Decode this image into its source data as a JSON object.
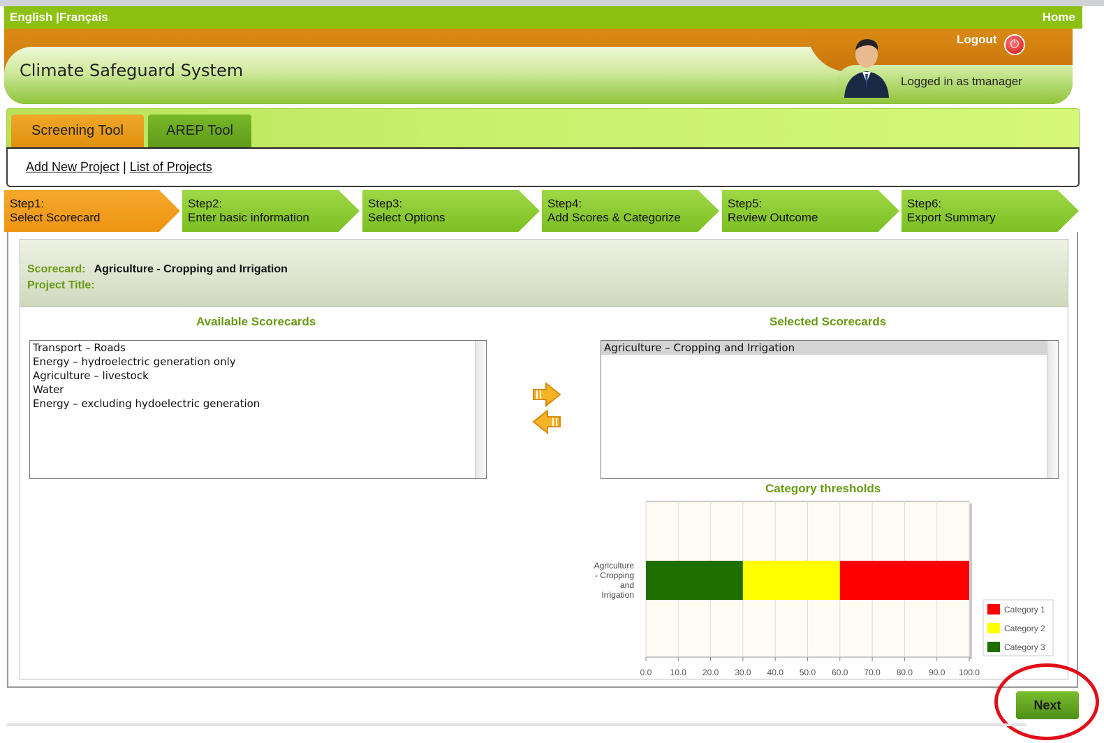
{
  "langbar": {
    "english": "English",
    "separator": " |",
    "francais": "Français",
    "home": "Home"
  },
  "header": {
    "title": "Climate Safeguard System",
    "logout": "Logout",
    "logged_in": "Logged in as tmanager"
  },
  "tools": {
    "screening": "Screening Tool",
    "arep": "AREP Tool"
  },
  "subnav": {
    "add_new": "Add New Project",
    "sep": " | ",
    "list": "List of Projects"
  },
  "steps": [
    {
      "num": "Step1:",
      "label": "Select Scorecard"
    },
    {
      "num": "Step2:",
      "label": "Enter basic information"
    },
    {
      "num": "Step3:",
      "label": "Select Options"
    },
    {
      "num": "Step4:",
      "label": "Add Scores & Categorize"
    },
    {
      "num": "Step5:",
      "label": "Review Outcome"
    },
    {
      "num": "Step6:",
      "label": "Export Summary"
    }
  ],
  "card": {
    "scorecard_label": "Scorecard:",
    "scorecard_value": "Agriculture - Cropping and Irrigation",
    "project_title_label": "Project Title:"
  },
  "available": {
    "title": "Available Scorecards",
    "items": [
      "Transport – Roads",
      "Energy – hydroelectric generation only",
      "Agriculture – livestock",
      "Water",
      "Energy – excluding hydoelectric generation"
    ]
  },
  "selected": {
    "title": "Selected Scorecards",
    "items": [
      "Agriculture – Cropping and Irrigation"
    ]
  },
  "chart_data": {
    "type": "bar",
    "title": "Category thresholds",
    "orientation": "horizontal-stacked",
    "categories": [
      "Agriculture - Cropping and Irrigation"
    ],
    "category_lines": [
      "Agriculture",
      "- Cropping",
      "and",
      "Irrigation"
    ],
    "series": [
      {
        "name": "Category 3",
        "values": [
          30
        ],
        "color": "#1e6e00"
      },
      {
        "name": "Category 2",
        "values": [
          30
        ],
        "color": "#ffff00"
      },
      {
        "name": "Category 1",
        "values": [
          40
        ],
        "color": "#ff0000"
      }
    ],
    "legend": [
      "Category 1",
      "Category 2",
      "Category 3"
    ],
    "xlim": [
      0,
      100
    ],
    "xticks": [
      "0.0",
      "10.0",
      "20.0",
      "30.0",
      "40.0",
      "50.0",
      "60.0",
      "70.0",
      "80.0",
      "90.0",
      "100.0"
    ],
    "grid": true,
    "legend_position": "bottom-right"
  },
  "next": "Next"
}
